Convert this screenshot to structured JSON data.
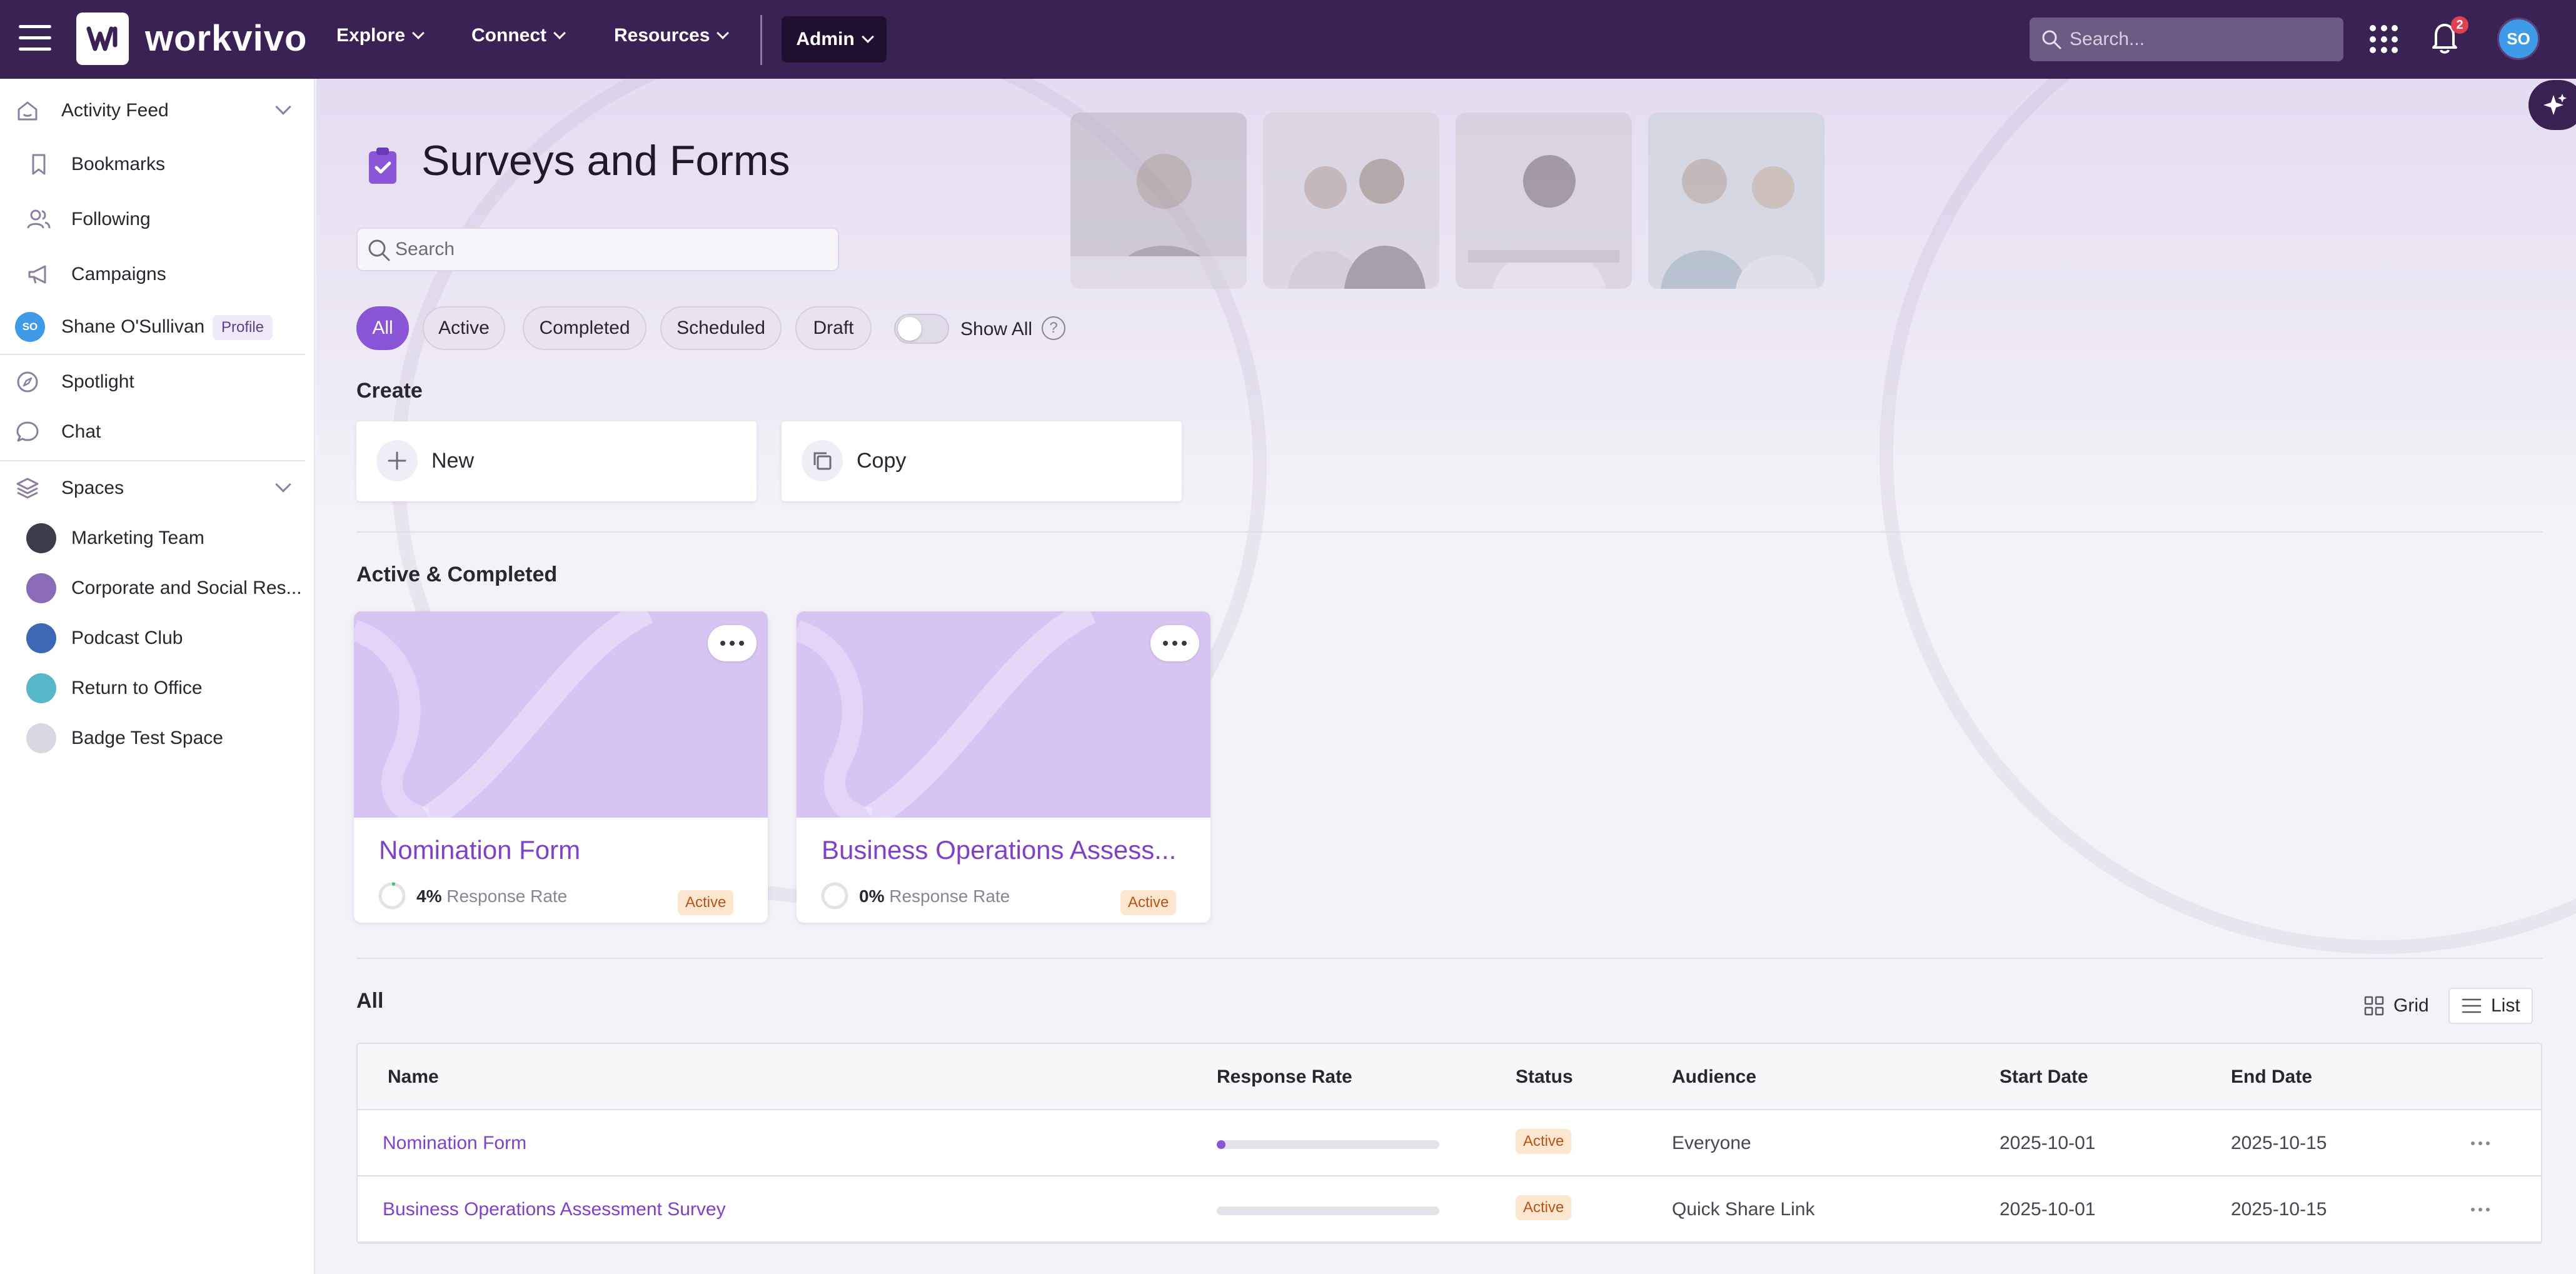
{
  "topbar": {
    "brand": "workvivo",
    "nav": [
      {
        "label": "Explore"
      },
      {
        "label": "Connect"
      },
      {
        "label": "Resources"
      }
    ],
    "admin_label": "Admin",
    "search_placeholder": "Search...",
    "notification_count": "2",
    "avatar_initials": "SO"
  },
  "sidebar": {
    "activity_feed": "Activity Feed",
    "bookmarks": "Bookmarks",
    "following": "Following",
    "campaigns": "Campaigns",
    "profile_name": "Shane O'Sullivan",
    "profile_badge": "Profile",
    "profile_initials": "SO",
    "spotlight": "Spotlight",
    "chat": "Chat",
    "spaces": "Spaces",
    "space_items": [
      {
        "label": "Marketing Team",
        "color": "#3a3d4a"
      },
      {
        "label": "Corporate and Social Res...",
        "color": "#8a6bb8"
      },
      {
        "label": "Podcast Club",
        "color": "#3b67b4"
      },
      {
        "label": "Return to Office",
        "color": "#56b7c9"
      },
      {
        "label": "Badge Test Space",
        "color": "#d9d7df"
      }
    ]
  },
  "main": {
    "page_title": "Surveys and Forms",
    "search_placeholder": "Search",
    "filters": [
      "All",
      "Active",
      "Completed",
      "Scheduled",
      "Draft"
    ],
    "active_filter": "All",
    "show_all_label": "Show All",
    "help_glyph": "?",
    "create_title": "Create",
    "create_new": "New",
    "create_copy": "Copy",
    "active_completed_title": "Active & Completed",
    "cards": [
      {
        "title": "Nomination Form",
        "rate": "4%",
        "rate_label": "Response Rate",
        "status": "Active",
        "progress": 0.04
      },
      {
        "title": "Business Operations Assess...",
        "rate": "0%",
        "rate_label": "Response Rate",
        "status": "Active",
        "progress": 0
      }
    ],
    "all_title": "All",
    "view_grid": "Grid",
    "view_list": "List",
    "table": {
      "headers": [
        "Name",
        "Response Rate",
        "Status",
        "Audience",
        "Start Date",
        "End Date"
      ],
      "rows": [
        {
          "name": "Nomination Form",
          "progress": 0.04,
          "status": "Active",
          "audience": "Everyone",
          "start": "2025-10-01",
          "end": "2025-10-15"
        },
        {
          "name": "Business Operations Assessment Survey",
          "progress": 0,
          "status": "Active",
          "audience": "Quick Share Link",
          "start": "2025-10-01",
          "end": "2025-10-15"
        }
      ]
    }
  },
  "colors": {
    "topbar": "#3b2255",
    "accent": "#8a55d6",
    "link": "#8040c8",
    "status_bg": "#fde6cf",
    "status_text": "#b3541a"
  }
}
